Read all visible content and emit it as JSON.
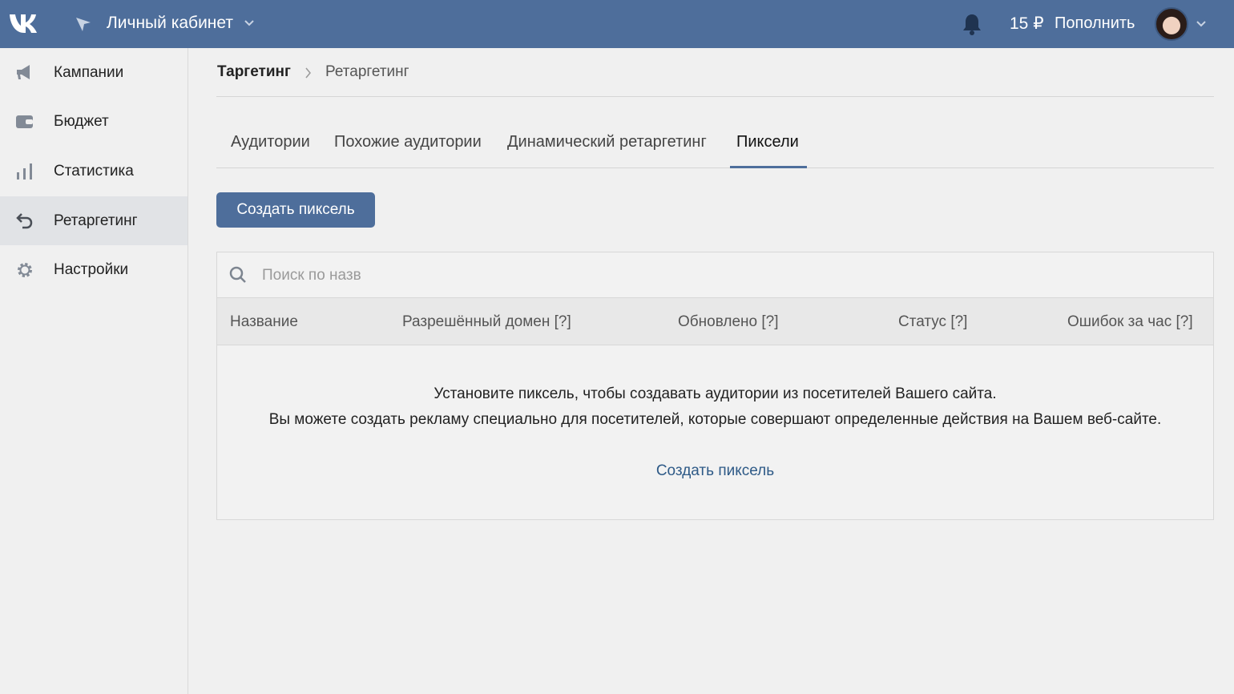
{
  "header": {
    "logo_icon": "vk-logo-icon",
    "cabinet_icon": "cursor-arrow-icon",
    "cabinet_title": "Личный кабинет",
    "balance": "15 ₽",
    "topup_label": "Пополнить",
    "bell_icon": "bell-icon",
    "accent_color": "#4e6e9b"
  },
  "sidebar": {
    "items": [
      {
        "label": "Кампании",
        "icon": "megaphone-icon",
        "active": false
      },
      {
        "label": "Бюджет",
        "icon": "wallet-icon",
        "active": false
      },
      {
        "label": "Статистика",
        "icon": "bar-chart-icon",
        "active": false
      },
      {
        "label": "Ретаргетинг",
        "icon": "return-arrow-icon",
        "active": true
      },
      {
        "label": "Настройки",
        "icon": "gear-icon",
        "active": false
      }
    ]
  },
  "breadcrumb": {
    "root": "Таргетинг",
    "current": "Ретаргетинг"
  },
  "tabs": [
    {
      "label": "Аудитории",
      "active": false
    },
    {
      "label": "Похожие аудитории",
      "active": false
    },
    {
      "label": "Динамический ретаргетинг",
      "active": false
    },
    {
      "label": "Пиксели",
      "active": true
    }
  ],
  "create_button_label": "Создать пиксель",
  "search": {
    "placeholder": "Поиск по назв",
    "value": ""
  },
  "table": {
    "columns": [
      "Название",
      "Разрешённый домен [?]",
      "Обновлено [?]",
      "Статус [?]",
      "Ошибок за час [?]"
    ]
  },
  "empty_state": {
    "line1": "Установите пиксель, чтобы создавать аудитории из посетителей Вашего сайта.",
    "line2": "Вы можете создать рекламу специально для посетителей, которые совершают определенные действия на Вашем веб-сайте.",
    "link": "Создать пиксель"
  }
}
